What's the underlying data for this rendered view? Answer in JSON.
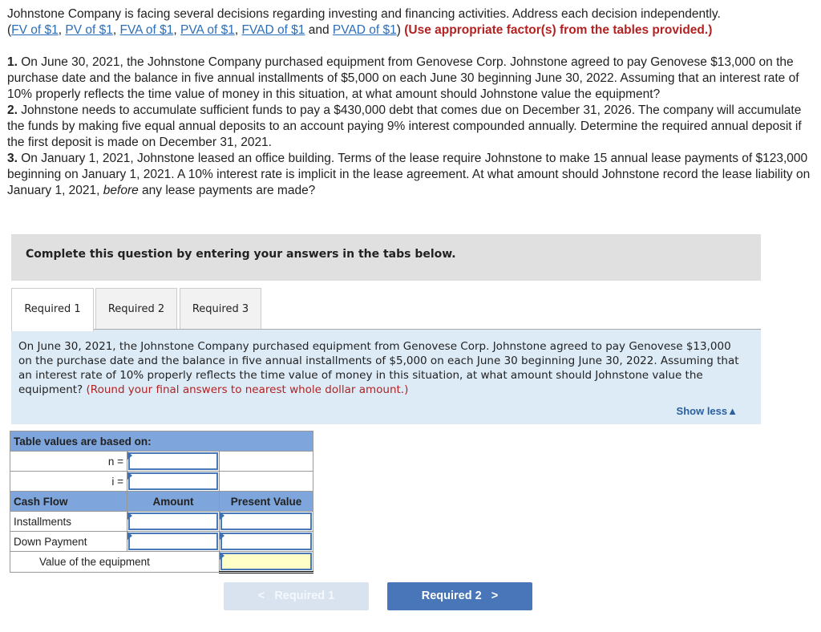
{
  "intro": {
    "text": "Johnstone Company is facing several decisions regarding investing and financing activities. Address each decision independently.",
    "links": [
      "FV of $1",
      "PV of $1",
      "FVA of $1",
      "PVA of $1",
      "FVAD of $1",
      "PVAD of $1"
    ],
    "and": "and",
    "instruction": "(Use appropriate factor(s) from the tables provided.)"
  },
  "problems": [
    {
      "num": "1.",
      "text": "On June 30, 2021, the Johnstone Company purchased equipment from Genovese Corp. Johnstone agreed to pay Genovese $13,000 on the purchase date and the balance in five annual installments of $5,000 on each June 30 beginning June 30, 2022. Assuming that an interest rate of 10% properly reflects the time value of money in this situation, at what amount should Johnstone value the equipment?"
    },
    {
      "num": "2.",
      "text": "Johnstone needs to accumulate sufficient funds to pay a $430,000 debt that comes due on December 31, 2026. The company will accumulate the funds by making five equal annual deposits to an account paying 9% interest compounded annually. Determine the required annual deposit if the first deposit is made on December 31, 2021."
    },
    {
      "num": "3.",
      "text_before": "On January 1, 2021, Johnstone leased an office building. Terms of the lease require Johnstone to make 15 annual lease payments of $123,000 beginning on January 1, 2021. A 10% interest rate is implicit in the lease agreement. At what amount should Johnstone record the lease liability on January 1, 2021, ",
      "italic": "before",
      "text_after": " any lease payments are made?"
    }
  ],
  "banner": "Complete this question by entering your answers in the tabs below.",
  "tabs": [
    {
      "label": "Required 1",
      "active": true
    },
    {
      "label": "Required 2",
      "active": false
    },
    {
      "label": "Required 3",
      "active": false
    }
  ],
  "panel": {
    "description": "On June 30, 2021, the Johnstone Company purchased equipment from Genovese Corp. Johnstone agreed to pay Genovese $13,000 on the purchase date and the balance in five annual installments of $5,000 on each June 30 beginning June 30, 2022. Assuming that an interest rate of 10% properly reflects the time value of money in this situation, at what amount should Johnstone value the equipment?",
    "hint": "(Round your final answers to nearest whole dollar amount.)",
    "show_less": "Show less",
    "show_less_icon": "▲"
  },
  "table": {
    "header": "Table values are based on:",
    "n_label": "n =",
    "i_label": "i =",
    "n_value": "",
    "i_value": "",
    "columns": [
      "Cash Flow",
      "Amount",
      "Present Value"
    ],
    "rows": [
      {
        "label": "Installments",
        "amount": "",
        "pv": ""
      },
      {
        "label": "Down Payment",
        "amount": "",
        "pv": ""
      }
    ],
    "total_label": "Value of the equipment",
    "total_value": ""
  },
  "nav": {
    "prev_label": "Required 1",
    "prev_icon": "<",
    "next_label": "Required 2",
    "next_icon": ">"
  }
}
